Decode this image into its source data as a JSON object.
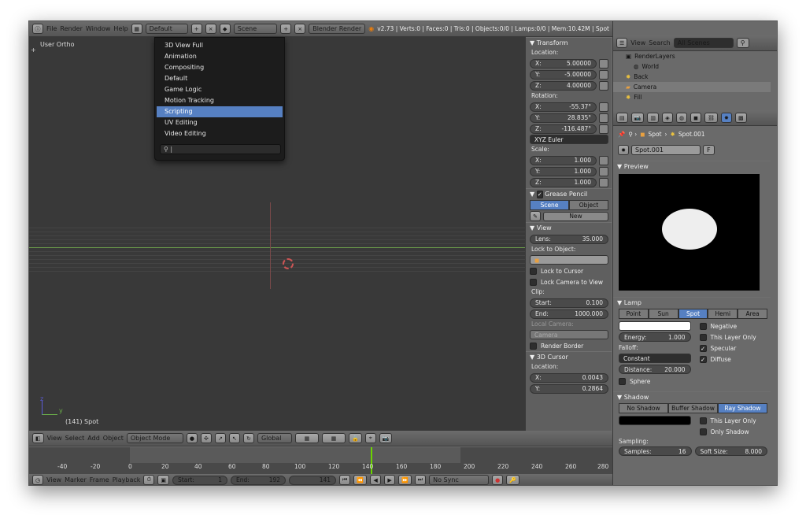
{
  "topbar": {
    "menus": [
      "File",
      "Render",
      "Window",
      "Help"
    ],
    "layout_value": "Default",
    "scene_value": "Scene",
    "engine_value": "Blender Render",
    "stats": "v2.73 | Verts:0 | Faces:0 | Tris:0 | Objects:0/0 | Lamps:0/0 | Mem:10.42M | Spot"
  },
  "viewport": {
    "label": "User Ortho",
    "object_label": "(141) Spot",
    "axis_y": "y",
    "axis_z": "z"
  },
  "layout_menu": {
    "items": [
      "3D View Full",
      "Animation",
      "Compositing",
      "Default",
      "Game Logic",
      "Motion Tracking",
      "Scripting",
      "UV Editing",
      "Video Editing"
    ],
    "selected": "Scripting",
    "search_value": ""
  },
  "npanel": {
    "transform_title": "Transform",
    "location_label": "Location:",
    "location": [
      {
        "axis": "X:",
        "value": "5.00000"
      },
      {
        "axis": "Y:",
        "value": "-5.00000"
      },
      {
        "axis": "Z:",
        "value": "4.00000"
      }
    ],
    "rotation_label": "Rotation:",
    "rotation": [
      {
        "axis": "X:",
        "value": "-55.37°"
      },
      {
        "axis": "Y:",
        "value": "28.835°"
      },
      {
        "axis": "Z:",
        "value": "-116.487°"
      }
    ],
    "rotation_mode": "XYZ Euler",
    "scale_label": "Scale:",
    "scale": [
      {
        "axis": "X:",
        "value": "1.000"
      },
      {
        "axis": "Y:",
        "value": "1.000"
      },
      {
        "axis": "Z:",
        "value": "1.000"
      }
    ],
    "grease_title": "Grease Pencil",
    "grease_tabs": [
      "Scene",
      "Object"
    ],
    "grease_new": "New",
    "view_title": "View",
    "lens_label": "Lens:",
    "lens_value": "35.000",
    "lock_to_object": "Lock to Object:",
    "lock_to_cursor": "Lock to Cursor",
    "lock_camera": "Lock Camera to View",
    "clip_label": "Clip:",
    "clip_start_label": "Start:",
    "clip_start": "0.100",
    "clip_end_label": "End:",
    "clip_end": "1000.000",
    "local_camera": "Local Camera:",
    "camera_field": "Camera",
    "render_border": "Render Border",
    "cursor_title": "3D Cursor",
    "cursor_location": "Location:",
    "cursor_x": "0.0043",
    "cursor_y": "0.2864"
  },
  "outliner": {
    "menus": [
      "View",
      "Search"
    ],
    "filter": "All Scenes",
    "items": [
      "RenderLayers",
      "World",
      "Back",
      "Camera",
      "Fill"
    ]
  },
  "properties": {
    "breadcrumb": [
      "Spot",
      "Spot.001"
    ],
    "datablock": "Spot.001",
    "fake_user": "F",
    "preview_title": "Preview",
    "lamp_title": "Lamp",
    "lamp_types": [
      "Point",
      "Sun",
      "Spot",
      "Hemi",
      "Area"
    ],
    "lamp_active": "Spot",
    "negative": "Negative",
    "energy_label": "Energy:",
    "energy": "1.000",
    "this_layer_only": "This Layer Only",
    "falloff_label": "Falloff:",
    "specular": "Specular",
    "falloff": "Constant",
    "diffuse": "Diffuse",
    "distance_label": "Distance:",
    "distance": "20.000",
    "sphere": "Sphere",
    "shadow_title": "Shadow",
    "shadow_types": [
      "No Shadow",
      "Buffer Shadow",
      "Ray Shadow"
    ],
    "shadow_active": "Ray Shadow",
    "shadow_layer": "This Layer Only",
    "only_shadow": "Only Shadow",
    "sampling": "Sampling:",
    "samples_label": "Samples:",
    "samples": "16",
    "soft_size_label": "Soft Size:",
    "soft_size": "8.000"
  },
  "view3d_header": {
    "menus": [
      "View",
      "Select",
      "Add",
      "Object"
    ],
    "mode": "Object Mode",
    "orientation": "Global"
  },
  "timeline": {
    "ticks": [
      "-40",
      "-20",
      "0",
      "20",
      "40",
      "60",
      "80",
      "100",
      "120",
      "140",
      "160",
      "180",
      "200",
      "220",
      "240",
      "260",
      "280"
    ],
    "menus": [
      "View",
      "Marker",
      "Frame",
      "Playback"
    ],
    "start_label": "Start:",
    "start": "1",
    "end_label": "End:",
    "end": "192",
    "current": "141",
    "sync": "No Sync"
  },
  "colors": {
    "accent": "#5680c2",
    "playhead": "#6bd400"
  }
}
